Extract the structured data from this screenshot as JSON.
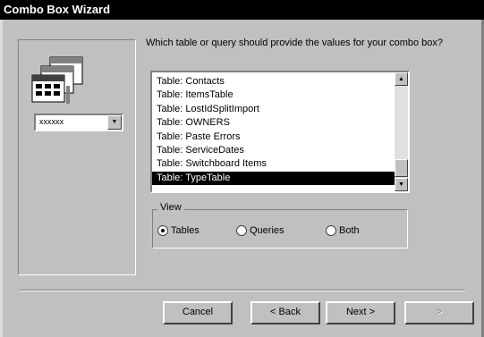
{
  "window": {
    "title": "Combo Box Wizard"
  },
  "preview": {
    "combo_value": "xxxxxx"
  },
  "prompt": "Which table or query should provide the values for your combo box?",
  "list": {
    "items": [
      "Table: Contacts",
      "Table: ItemsTable",
      "Table: LostIdSplitImport",
      "Table: OWNERS",
      "Table: Paste Errors",
      "Table: ServiceDates",
      "Table: Switchboard Items",
      "Table: TypeTable"
    ],
    "selected": "Table: TypeTable"
  },
  "view": {
    "legend": "View",
    "options": [
      "Tables",
      "Queries",
      "Both"
    ],
    "selected": "Tables"
  },
  "buttons": {
    "cancel": "Cancel",
    "back": "< Back",
    "next": "Next >",
    "finish": ">"
  },
  "colors": {
    "titlebar": "#000000",
    "face": "#c0c0c0",
    "selection": "#000000"
  }
}
